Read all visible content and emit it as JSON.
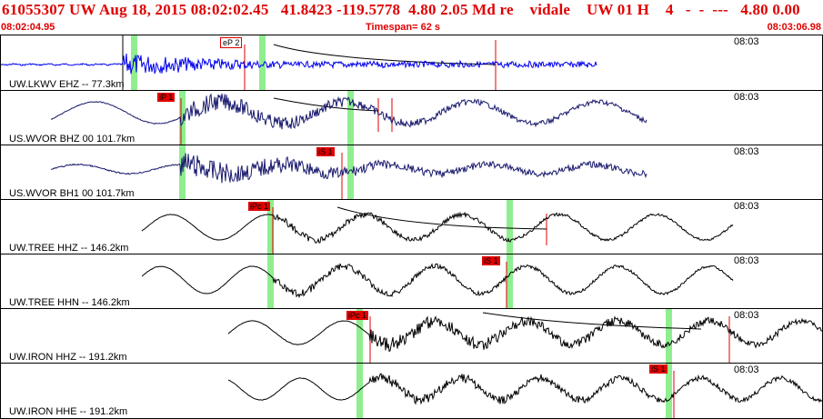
{
  "header": {
    "title": "61055307 UW Aug 18, 2015 08:02:02.45   41.8423 -119.5778  4.80 2.05 Md re    vidale    UW 01 H    4   -  -  ---   4.80 0.00",
    "start_time": "08:02:04.95",
    "timespan": "Timespan=  62 s",
    "end_time": "08:03:06.98"
  },
  "colors": {
    "header_text": "#e00000",
    "blue_trace": "#0000ee",
    "navy_trace": "#1a1a6e",
    "black_trace": "#000000",
    "green_band": "#90ee90",
    "pick": "#e00000"
  },
  "panels": [
    {
      "label": "UW.LKWV EHZ -- 77.3km",
      "tick": "08:03",
      "pick": "eP 2",
      "pick_style": "outline"
    },
    {
      "label": "US.WVOR BHZ 00 101.7km",
      "tick": "08:03",
      "pick": "iP 1",
      "pick_style": "filled"
    },
    {
      "label": "US.WVOR BH1 00 101.7km",
      "tick": "08:03",
      "pick": "iS 1",
      "pick_style": "filled"
    },
    {
      "label": "UW.TREE HHZ -- 146.2km",
      "tick": "08:03",
      "pick": "iPc 1",
      "pick_style": "filled"
    },
    {
      "label": "UW.TREE HHN -- 146.2km",
      "tick": "08:03",
      "pick": "iS 1",
      "pick_style": "filled"
    },
    {
      "label": "UW.IRON HHZ -- 191.2km",
      "tick": "08:03",
      "pick": "iPc 1",
      "pick_style": "filled"
    },
    {
      "label": "UW.IRON HHE -- 191.2km",
      "tick": "08:03",
      "pick": "iS 1",
      "pick_style": "filled"
    }
  ]
}
